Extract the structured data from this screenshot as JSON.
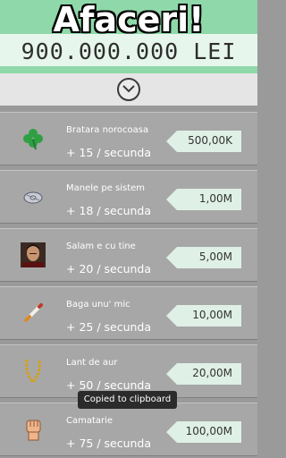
{
  "header": {
    "title": "Afaceri!",
    "money": "900.000.000 LEI",
    "expand_icon": "chevron-down-icon"
  },
  "colors": {
    "header_green": "#8fd8a9",
    "row_gray": "#a7a7a7",
    "price_tag": "#dff0e6"
  },
  "businesses": [
    {
      "name": "Bratara norocoasa",
      "rate": "+ 15 / secunda",
      "price": "500,00K",
      "icon": "clover-icon"
    },
    {
      "name": "Manele pe sistem",
      "rate": "+ 18 / secunda",
      "price": "1,00M",
      "icon": "cd-icon"
    },
    {
      "name": "Salam e cu tine",
      "rate": "+ 20 / secunda",
      "price": "5,00M",
      "icon": "singer-portrait-icon"
    },
    {
      "name": "Baga unu' mic",
      "rate": "+ 25 / secunda",
      "price": "10,00M",
      "icon": "cigarette-icon"
    },
    {
      "name": "Lant de aur",
      "rate": "+ 50 / secunda",
      "price": "20,00M",
      "icon": "gold-chain-icon"
    },
    {
      "name": "Camatarie",
      "rate": "+ 75 / secunda",
      "price": "100,00M",
      "icon": "fist-icon"
    }
  ],
  "toast": {
    "text": "Copied to clipboard"
  }
}
